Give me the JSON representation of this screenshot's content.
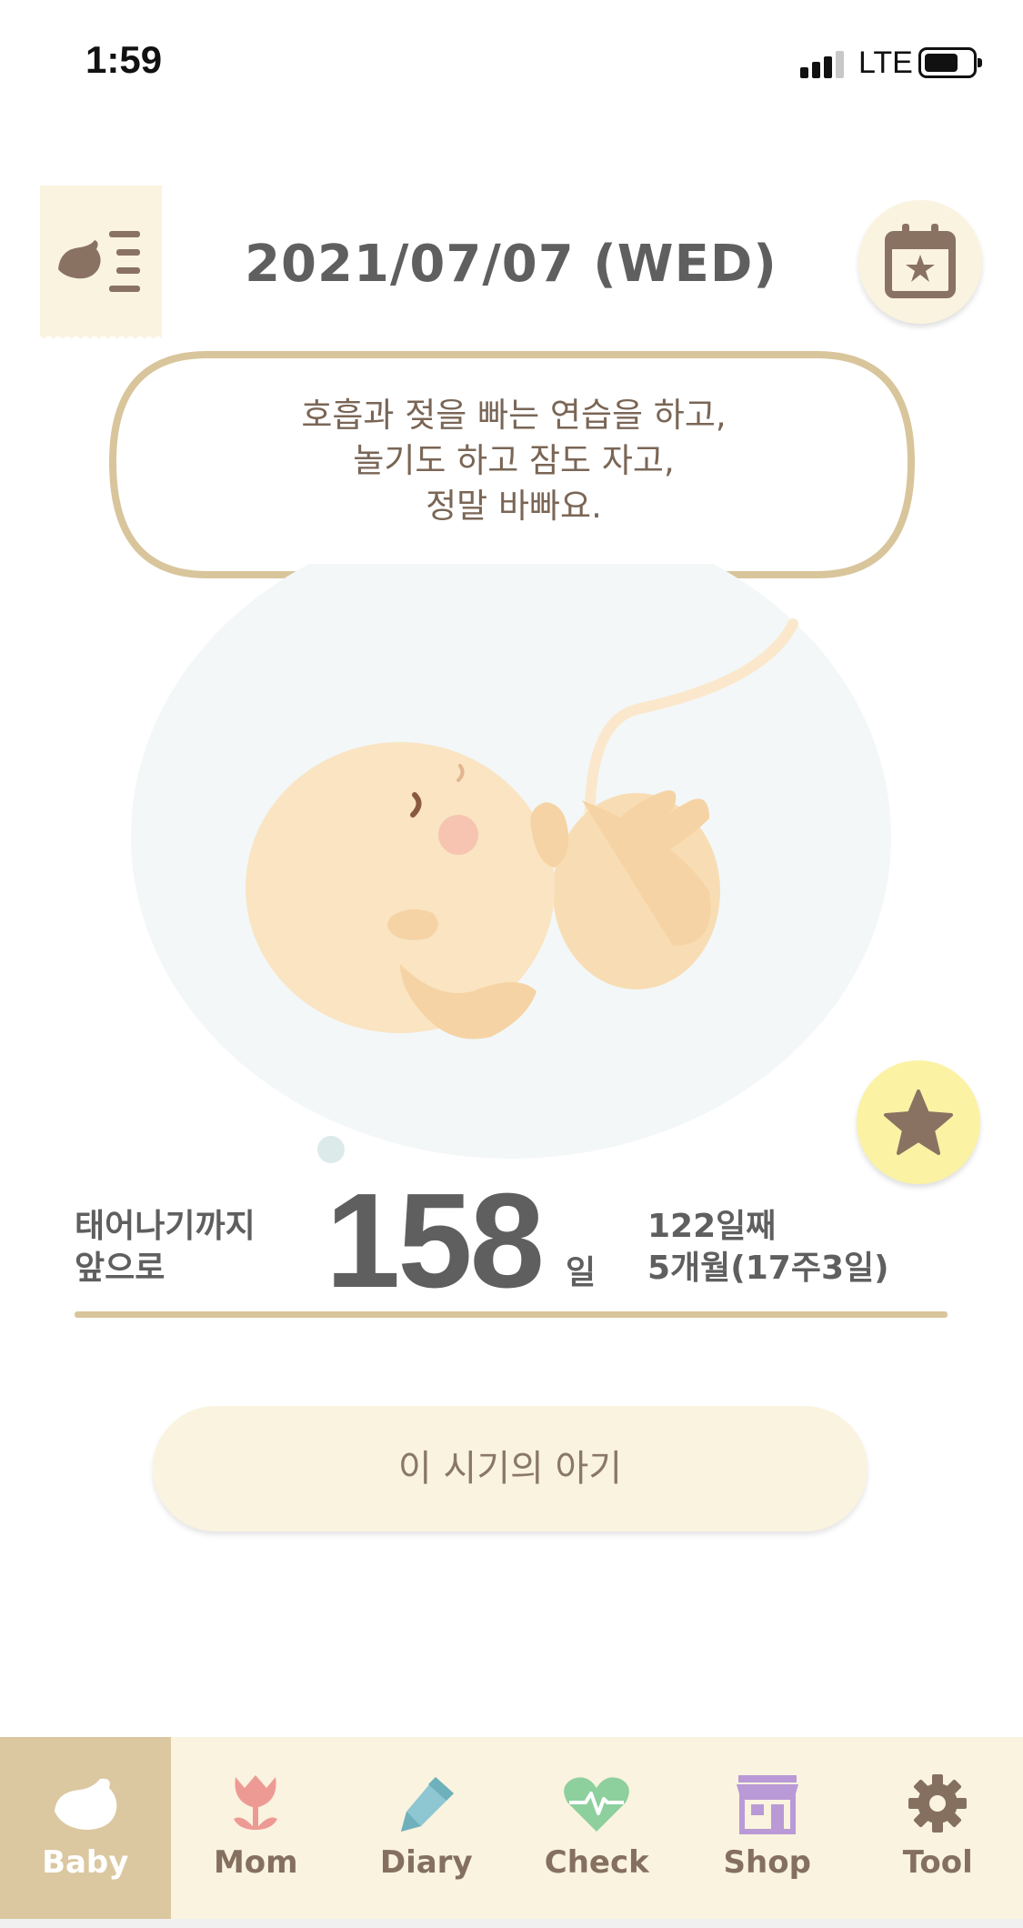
{
  "status_bar": {
    "time": "1:59",
    "network": "LTE"
  },
  "header": {
    "date": "2021/07/07 (WED)"
  },
  "bubble": {
    "line1": "호흡과 젖을 빠는 연습을 하고,",
    "line2": "놀기도 하고 잠도 자고,",
    "line3": "정말 바빠요."
  },
  "countdown": {
    "label_line1": "태어나기까지",
    "label_line2": "앞으로",
    "days": "158",
    "unit": "일",
    "day_count": "122일째",
    "month_week": "5개월(17주3일)"
  },
  "baby_button": {
    "label": "이 시기의 아기"
  },
  "nav": {
    "items": [
      {
        "label": "Baby",
        "icon": "bird-icon",
        "active": true
      },
      {
        "label": "Mom",
        "icon": "tulip-icon",
        "active": false
      },
      {
        "label": "Diary",
        "icon": "pencil-icon",
        "active": false
      },
      {
        "label": "Check",
        "icon": "heart-pulse-icon",
        "active": false
      },
      {
        "label": "Shop",
        "icon": "store-icon",
        "active": false
      },
      {
        "label": "Tool",
        "icon": "gear-icon",
        "active": false
      }
    ]
  },
  "colors": {
    "accent_beige": "#d9c59b",
    "cream": "#faf3df",
    "text_gray": "#5f5f5f",
    "star_yellow": "#fbf2a4"
  }
}
